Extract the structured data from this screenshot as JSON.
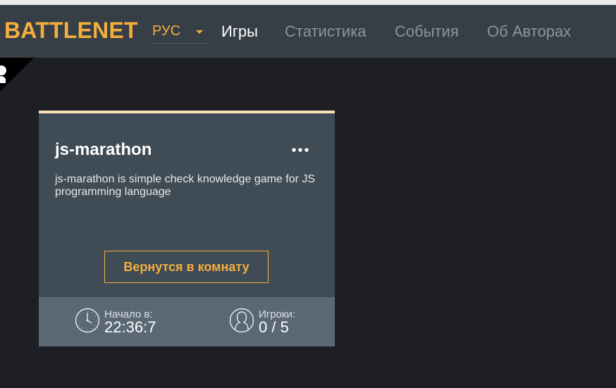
{
  "app": {
    "logo": "BATTLENET"
  },
  "language": {
    "selected": "РУС"
  },
  "nav": {
    "items": [
      {
        "label": "Игры",
        "active": true
      },
      {
        "label": "Статистика",
        "active": false
      },
      {
        "label": "События",
        "active": false
      },
      {
        "label": "Об Авторах",
        "active": false
      }
    ]
  },
  "card": {
    "title": "js-marathon",
    "description": "js-marathon is simple check knowledge game for JS programming language",
    "button_label": "Вернутся в комнату",
    "start": {
      "label": "Начало в:",
      "value": "22:36:7"
    },
    "players": {
      "label": "Игроки:",
      "value": "0 / 5"
    }
  },
  "colors": {
    "accent": "#f4ae3d",
    "navbar": "#363e46",
    "background": "#1d1f25",
    "card": "#3f4b55",
    "card_footer": "#5a6775",
    "card_top_border": "#f8dfb6"
  },
  "icons": {
    "menu": "more-horizontal-icon",
    "start": "clock-icon",
    "players": "user-icon",
    "ribbon": "github-corner-icon"
  }
}
